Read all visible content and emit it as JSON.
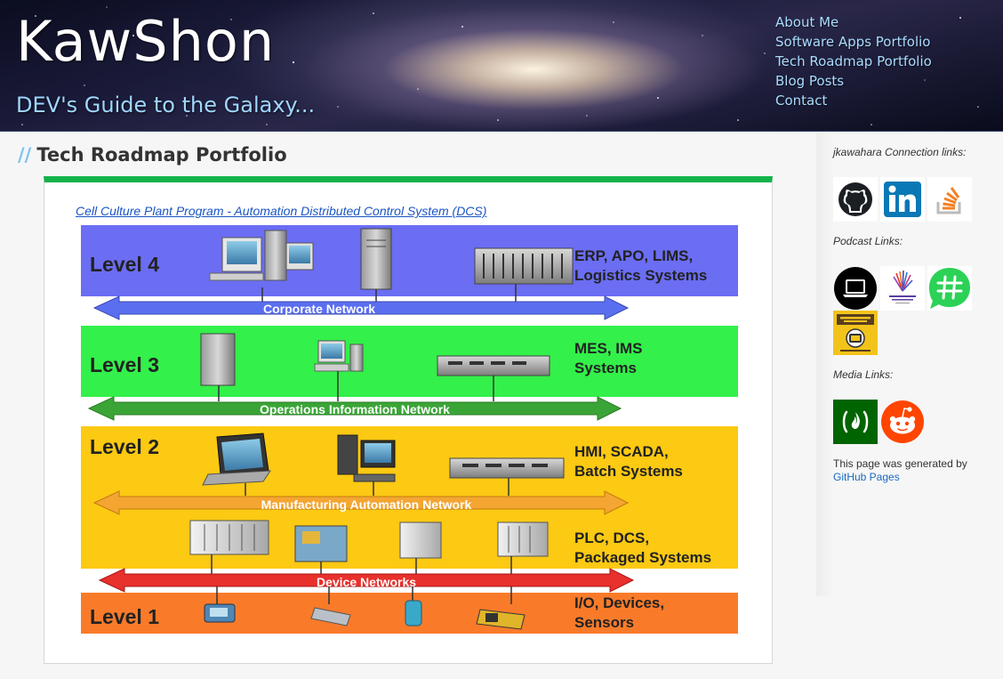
{
  "header": {
    "site_title": "KawShon",
    "tagline": "DEV's Guide to the Galaxy...",
    "nav": [
      {
        "label": "About Me"
      },
      {
        "label": "Software Apps Portfolio"
      },
      {
        "label": "Tech Roadmap Portfolio"
      },
      {
        "label": "Blog Posts"
      },
      {
        "label": "Contact"
      }
    ]
  },
  "main": {
    "heading_prefix": "//",
    "heading": "Tech Roadmap Portfolio",
    "diagram_link": "Cell Culture Plant Program - Automation Distributed Control System (DCS)",
    "diagram": {
      "levels": [
        {
          "label": "Level 4",
          "systems": [
            "ERP, APO, LIMS,",
            "Logistics Systems"
          ],
          "color": "#6b6df3"
        },
        {
          "label": "Level 3",
          "systems": [
            "MES, IMS",
            "Systems"
          ],
          "color": "#33f04a"
        },
        {
          "label": "Level 2",
          "systems": [
            "HMI, SCADA,",
            "Batch Systems"
          ],
          "color": "#fcc913"
        },
        {
          "label": "",
          "systems": [
            "PLC, DCS,",
            "Packaged Systems"
          ],
          "color": "#fcc913"
        },
        {
          "label": "Level 1",
          "systems": [
            "I/O, Devices,",
            "Sensors"
          ],
          "color": "#f97b2a"
        }
      ],
      "networks": [
        {
          "label": "Corporate Network",
          "color": "#5a6ef0"
        },
        {
          "label": "Operations Information Network",
          "color": "#3aa536"
        },
        {
          "label": "Manufacturing Automation Network",
          "color": "#f4a532"
        },
        {
          "label": "Device Networks",
          "color": "#e8302c"
        }
      ]
    }
  },
  "sidebar": {
    "connection_label": "jkawahara Connection links:",
    "connection_icons": [
      "github-icon",
      "linkedin-icon",
      "stackoverflow-icon"
    ],
    "podcast_label": "Podcast Links:",
    "podcast_icons": [
      "laptop-podcast-icon",
      "screaming-in-the-cloud-icon",
      "greenhorn-podcast-icon",
      "javascript-jabber-icon"
    ],
    "media_label": "Media Links:",
    "media_icons": [
      "freecodecamp-icon",
      "reddit-icon"
    ],
    "footer_text": "This page was generated by",
    "footer_link": "GitHub Pages"
  },
  "colors": {
    "accent_green": "#12b34a",
    "nav_text": "#a9dcff",
    "link_blue": "#1a55c4"
  }
}
